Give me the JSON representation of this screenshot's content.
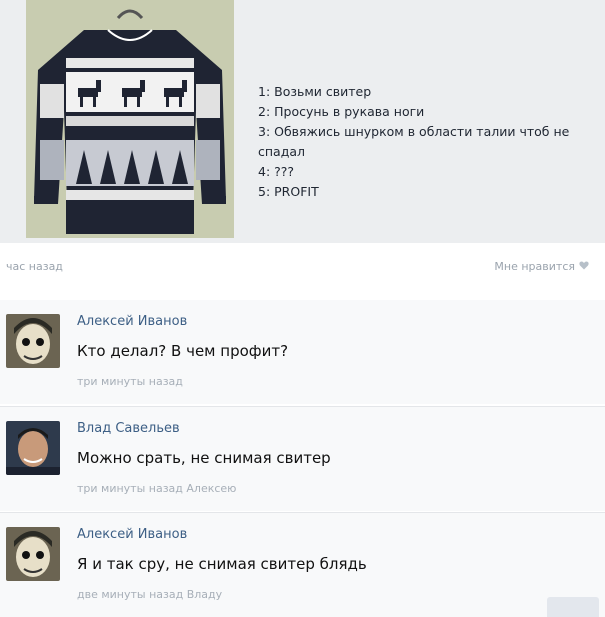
{
  "post": {
    "steps": [
      "1: Возьми свитер",
      "2: Просунь в рукава ноги",
      "3: Обвяжись шнурком в области талии чтоб не спадал",
      "4: ???",
      "5: PROFIT"
    ],
    "time": "час назад",
    "like_label": "Мне нравится"
  },
  "comments": [
    {
      "author": "Алексей Иванов",
      "text": "Кто делал? В чем профит?",
      "time": "три минуты назад"
    },
    {
      "author": "Влад Савельев",
      "text": "Можно срать, не снимая свитер",
      "time": "три минуты назад Алексею"
    },
    {
      "author": "Алексей Иванов",
      "text": "Я и так сру, не снимая свитер блядь",
      "time": "две минуты назад Владу"
    }
  ],
  "icons": {
    "heart": "heart-icon"
  },
  "colors": {
    "author_link": "#3d5f85",
    "post_background": "#eceef0"
  }
}
